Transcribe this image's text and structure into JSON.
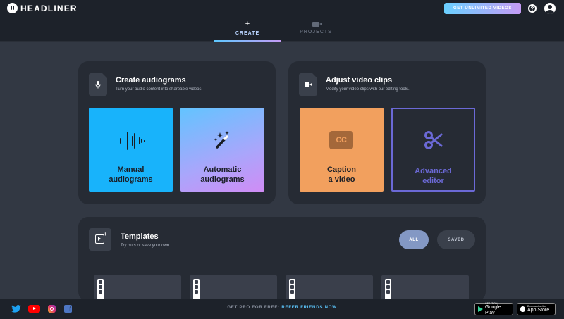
{
  "header": {
    "logo_text": "HEADLINER",
    "upgrade_label": "GET UNLIMITED VIDEOS",
    "help_symbol": "?"
  },
  "tabs": [
    {
      "label": "CREATE",
      "icon": "plus-icon",
      "active": true
    },
    {
      "label": "PROJECTS",
      "icon": "video-camera-icon",
      "active": false
    }
  ],
  "audio_panel": {
    "icon": "microphone-icon",
    "title": "Create audiograms",
    "subtitle": "Turn your audio content into shareable videos.",
    "cards": [
      {
        "label": "Manual\naudiograms",
        "icon": "waveform-icon",
        "color": "#18b3fb"
      },
      {
        "label": "Automatic\naudiograms",
        "icon": "magic-wand-icon",
        "color": "#a9a6fb"
      }
    ]
  },
  "video_panel": {
    "icon": "video-camera-icon",
    "title": "Adjust video clips",
    "subtitle": "Modify your video clips with our editing tools.",
    "cards": [
      {
        "label": "Caption\na video",
        "icon": "closed-caption-icon",
        "icon_text": "CC",
        "color": "#f2a05e"
      },
      {
        "label": "Advanced\neditor",
        "icon": "scissors-icon",
        "color": "#6b69d6"
      }
    ]
  },
  "templates": {
    "title": "Templates",
    "subtitle": "Try ours or save your own.",
    "filters": [
      {
        "label": "ALL",
        "active": true
      },
      {
        "label": "SAVED",
        "active": false
      }
    ],
    "items": [
      {
        "icons": [
          "instagram-icon",
          "facebook-icon",
          "twitter-icon"
        ]
      },
      {
        "icons": [
          "instagram-icon",
          "facebook-icon",
          "twitter-icon"
        ]
      },
      {
        "icons": [
          "instagram-icon",
          "facebook-icon",
          "twitter-icon"
        ]
      },
      {
        "icons": [
          "instagram-icon",
          "facebook-icon",
          "twitter-icon"
        ]
      }
    ]
  },
  "footer": {
    "promo_prefix": "GET PRO FOR FREE:",
    "promo_link": "REFER FRIENDS NOW",
    "social": [
      "twitter-icon",
      "youtube-icon",
      "instagram-icon",
      "facebook-icon"
    ],
    "google_play": {
      "sub": "GET IT ON",
      "name": "Google Play"
    },
    "app_store": {
      "sub": "Download on the",
      "name": "App Store"
    }
  },
  "colors": {
    "background": "#323843",
    "panel": "#262b34",
    "topbar": "#1d222a",
    "accent_blue": "#5dc8ff",
    "accent_purple": "#6b69d6"
  }
}
